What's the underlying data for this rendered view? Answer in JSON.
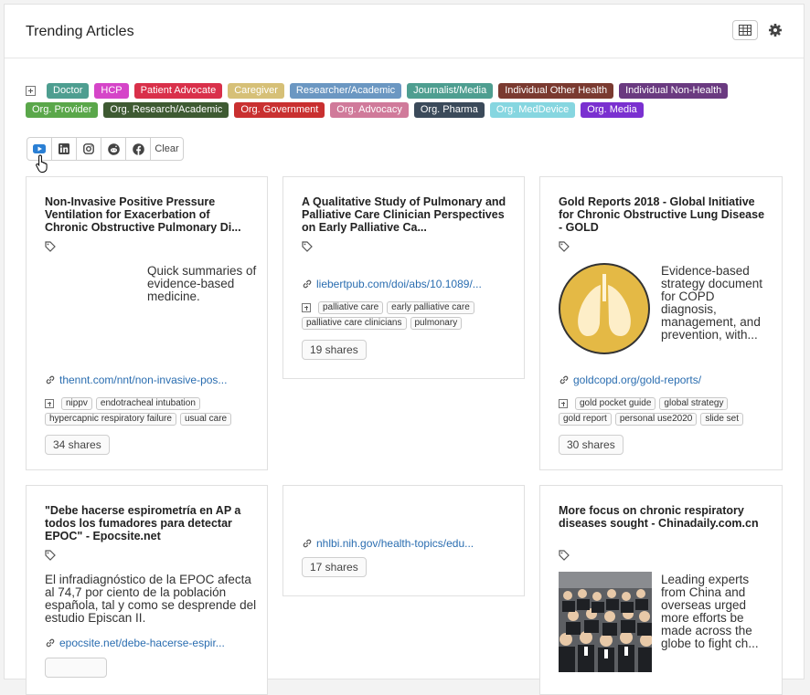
{
  "header": {
    "title": "Trending Articles"
  },
  "audience_tags": {
    "row1": [
      {
        "label": "Doctor",
        "color": "#4e9e90"
      },
      {
        "label": "HCP",
        "color": "#d545c8"
      },
      {
        "label": "Patient Advocate",
        "color": "#d9304a"
      },
      {
        "label": "Caregiver",
        "color": "#d6c077"
      },
      {
        "label": "Researcher/Academic",
        "color": "#6b97c2"
      },
      {
        "label": "Journalist/Media",
        "color": "#4e9e90"
      },
      {
        "label": "Individual Other Health",
        "color": "#7a3a30"
      },
      {
        "label": "Individual Non-Health",
        "color": "#6a3a80"
      }
    ],
    "row2": [
      {
        "label": "Org. Provider",
        "color": "#5aa74a"
      },
      {
        "label": "Org. Research/Academic",
        "color": "#3e5a32"
      },
      {
        "label": "Org. Government",
        "color": "#c93030"
      },
      {
        "label": "Org. Advocacy",
        "color": "#d07a9a"
      },
      {
        "label": "Org. Pharma",
        "color": "#3b4a5a"
      },
      {
        "label": "Org. MedDevice",
        "color": "#86d6e0"
      },
      {
        "label": "Org. Media",
        "color": "#7a30d0"
      }
    ]
  },
  "social_filter": {
    "buttons": [
      "youtube-icon",
      "linkedin-icon",
      "instagram-icon",
      "reddit-icon",
      "facebook-icon"
    ],
    "clear_label": "Clear"
  },
  "cards": [
    {
      "title": "Non-Invasive Positive Pressure Ventilation for Exacerbation of Chronic Obstructive Pulmonary Di...",
      "description": "Quick summaries of evidence-based medicine.",
      "link": "thennt.com/nnt/non-invasive-pos...",
      "keywords": [
        "nippv",
        "endotracheal intubation",
        "hypercapnic respiratory failure",
        "usual care"
      ],
      "shares": "34 shares"
    },
    {
      "title": "A Qualitative Study of Pulmonary and Palliative Care Clinician Perspectives on Early Palliative Ca...",
      "link": "liebertpub.com/doi/abs/10.1089/...",
      "keywords": [
        "palliative care",
        "early palliative care",
        "palliative care clinicians",
        "pulmonary"
      ],
      "shares": "19 shares"
    },
    {
      "title": "Gold Reports 2018 - Global Initiative for Chronic Obstructive Lung Disease - GOLD",
      "description": "Evidence-based strategy document for COPD diagnosis, management, and prevention, with...",
      "link": "goldcopd.org/gold-reports/",
      "keywords": [
        "gold pocket guide",
        "global strategy",
        "gold report",
        "personal use2020",
        "slide set"
      ],
      "shares": "30 shares"
    },
    {
      "title": "\"Debe hacerse espirometría en AP a todos los fumadores para detectar EPOC\" - Epocsite.net",
      "description": "El infradiagnóstico de la EPOC afecta al 74,7 por ciento de la población española, tal y como se desprende del estudio Episcan II.",
      "link": "epocsite.net/debe-hacerse-espir..."
    },
    {
      "link": "nhlbi.nih.gov/health-topics/edu...",
      "shares": "17 shares"
    },
    {
      "title": "More focus on chronic respiratory diseases sought - Chinadaily.com.cn",
      "description": "Leading experts from China and overseas urged more efforts be made across the globe to fight ch..."
    }
  ]
}
